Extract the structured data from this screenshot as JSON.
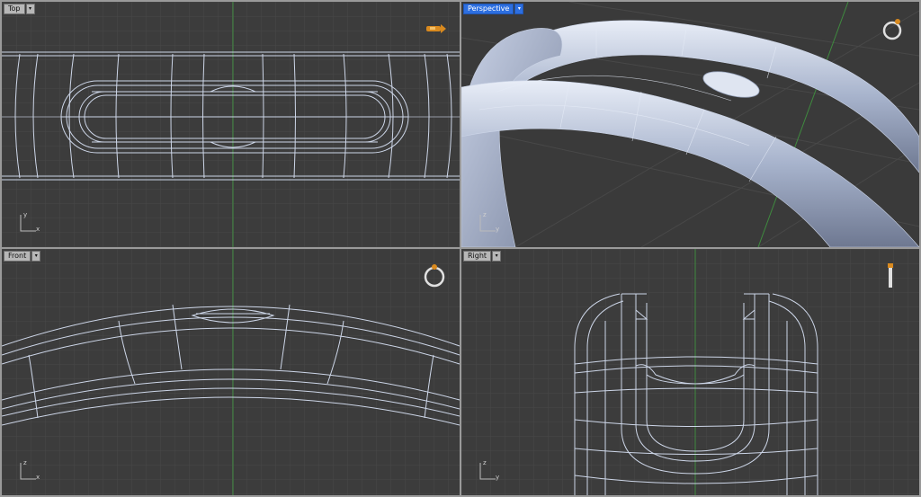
{
  "viewports": {
    "top": {
      "label": "Top",
      "axis_v": "y",
      "axis_h": "x"
    },
    "persp": {
      "label": "Perspective",
      "axis_v": "z",
      "axis_h": "y"
    },
    "front": {
      "label": "Front",
      "axis_v": "z",
      "axis_h": "x"
    },
    "right": {
      "label": "Right",
      "axis_v": "z",
      "axis_h": "y"
    }
  },
  "active_viewport": "persp",
  "dropdown_glyph": "▾",
  "colors": {
    "background": "#3c3c3c",
    "grid": "#4a4a4a",
    "wire": "#cdd6e8",
    "y_axis_line": "#3f8a3f",
    "x_axis_line": "#7a3a3a",
    "active_tab": "#2d6fe0"
  },
  "icons": {
    "top": "ring-side-orange-icon",
    "persp": "ring-icon",
    "front": "ring-icon",
    "right": "ring-upright-icon"
  }
}
